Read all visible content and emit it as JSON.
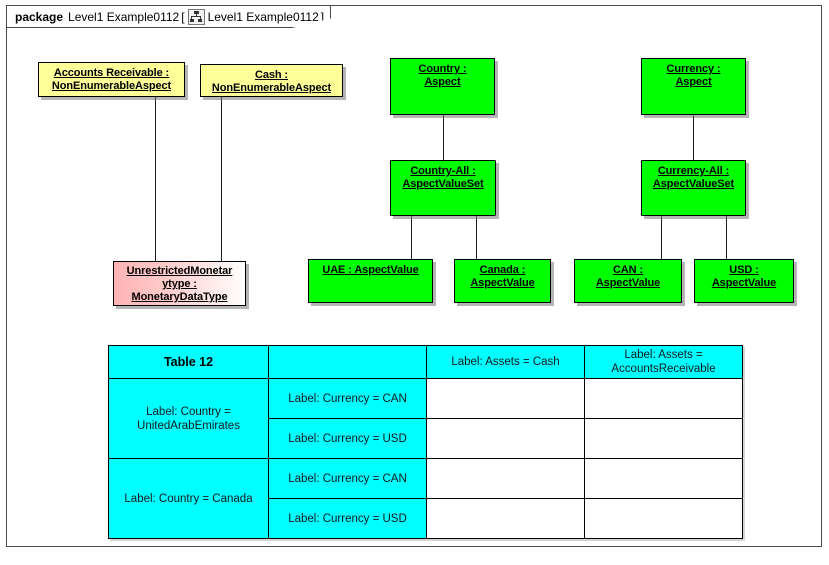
{
  "frame": {
    "keyword": "package",
    "name": "Level1 Example0112",
    "bracket_open": "[",
    "icon": "package-diagram-icon",
    "tab_name": "Level1 Example0112",
    "bracket_close": "]"
  },
  "colors": {
    "aspect_node": "#00FF00",
    "nonenumerable_node": "#FFFF99",
    "datatype_node": "#FFB3B3",
    "table_header": "#00FFFF",
    "border": "#000000",
    "connector": "#1A1A1A"
  },
  "nodes": [
    {
      "id": "accounts-receivable",
      "label": "Accounts Receivable :\nNonEnumerableAspect",
      "kind": "NonEnumerableAspect",
      "color": "yellow"
    },
    {
      "id": "cash",
      "label": "Cash :\nNonEnumerableAspect",
      "kind": "NonEnumerableAspect",
      "color": "yellow"
    },
    {
      "id": "country-aspect",
      "label": "Country :\nAspect",
      "kind": "Aspect",
      "color": "green"
    },
    {
      "id": "currency-aspect",
      "label": "Currency :\nAspect",
      "kind": "Aspect",
      "color": "green"
    },
    {
      "id": "country-all",
      "label": "Country-All :\nAspectValueSet",
      "kind": "AspectValueSet",
      "color": "green"
    },
    {
      "id": "currency-all",
      "label": "Currency-All :\nAspectValueSet",
      "kind": "AspectValueSet",
      "color": "green"
    },
    {
      "id": "uae",
      "label": "UAE : AspectValue",
      "kind": "AspectValue",
      "color": "green"
    },
    {
      "id": "canada",
      "label": "Canada :\nAspectValue",
      "kind": "AspectValue",
      "color": "green"
    },
    {
      "id": "can",
      "label": "CAN :\nAspectValue",
      "kind": "AspectValue",
      "color": "green"
    },
    {
      "id": "usd",
      "label": "USD :\nAspectValue",
      "kind": "AspectValue",
      "color": "green"
    },
    {
      "id": "unrestricted-monetary",
      "label": "UnrestrictedMonetar\nytype :\nMonetaryDataType",
      "kind": "MonetaryDataType",
      "color": "pink"
    }
  ],
  "table": {
    "title": "Table 12",
    "column_headers": [
      "Table 12",
      "",
      "Label: Assets = Cash",
      "Label: Assets =\nAccountsReceivable"
    ],
    "row_groups": [
      {
        "country": "Label: Country =\nUnitedArabEmirates",
        "rows": [
          {
            "currency": "Label: Currency = CAN",
            "cash": "",
            "accounts_receivable": ""
          },
          {
            "currency": "Label: Currency = USD",
            "cash": "",
            "accounts_receivable": ""
          }
        ]
      },
      {
        "country": "Label: Country = Canada",
        "rows": [
          {
            "currency": "Label: Currency = CAN",
            "cash": "",
            "accounts_receivable": ""
          },
          {
            "currency": "Label: Currency = USD",
            "cash": "",
            "accounts_receivable": ""
          }
        ]
      }
    ]
  }
}
